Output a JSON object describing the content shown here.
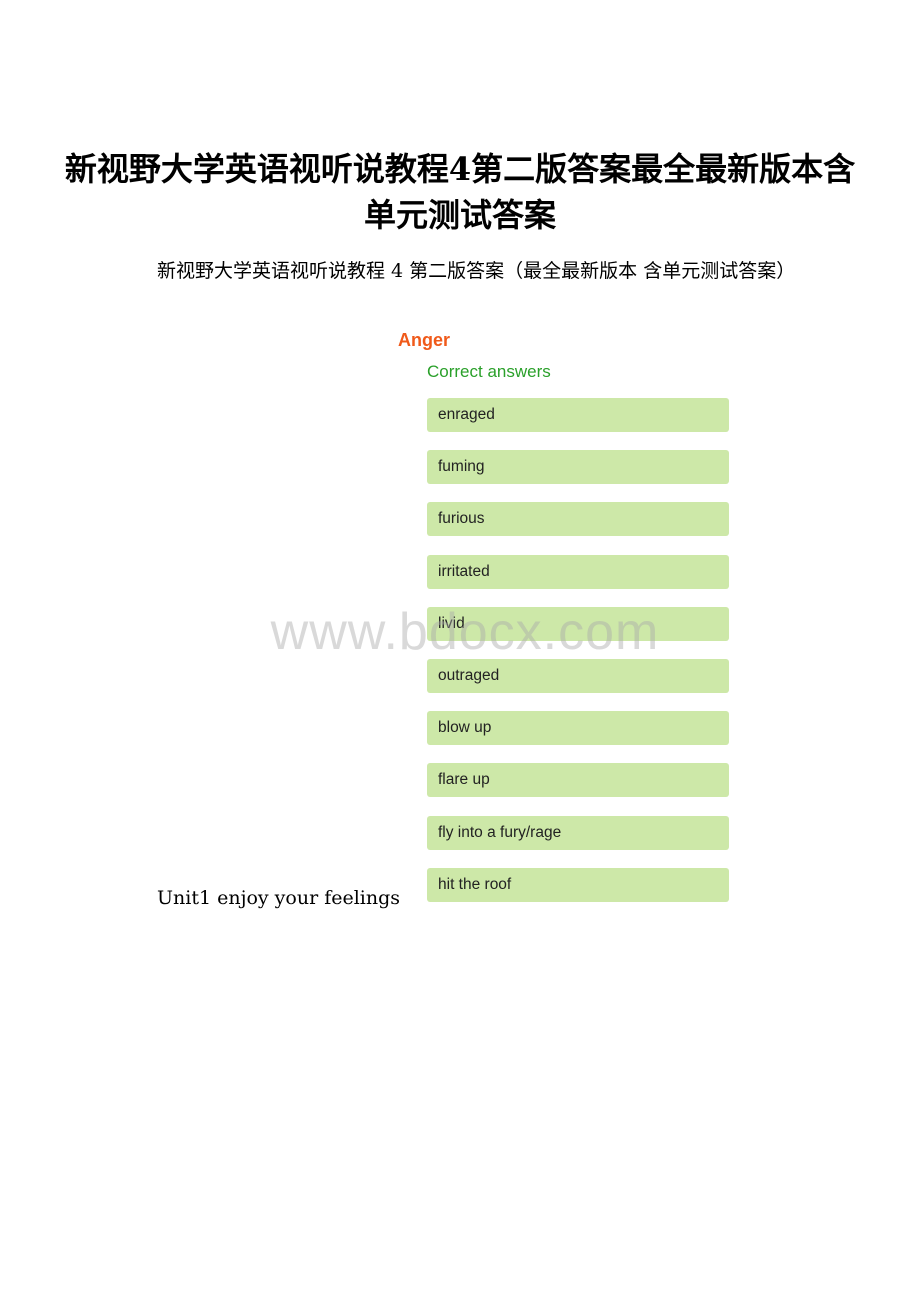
{
  "document": {
    "title": "新视野大学英语视听说教程4第二版答案最全最新版本含单元测试答案",
    "intro": "新视野大学英语视听说教程 4 第二版答案（最全最新版本 含单元测试答案）",
    "unit_heading": "Unit1 enjoy your feelings",
    "watermark": "www.bdocx.com"
  },
  "exercise": {
    "section_title": "Anger",
    "correct_label": "Correct answers",
    "answers": [
      "enraged",
      "fuming",
      "furious",
      "irritated",
      "livid",
      "outraged",
      "blow up",
      "flare up",
      "fly into a fury/rage",
      "hit the roof"
    ]
  },
  "colors": {
    "section_title": "#f05a1a",
    "correct_label": "#2aa02a",
    "answer_background": "#cde8a8"
  }
}
